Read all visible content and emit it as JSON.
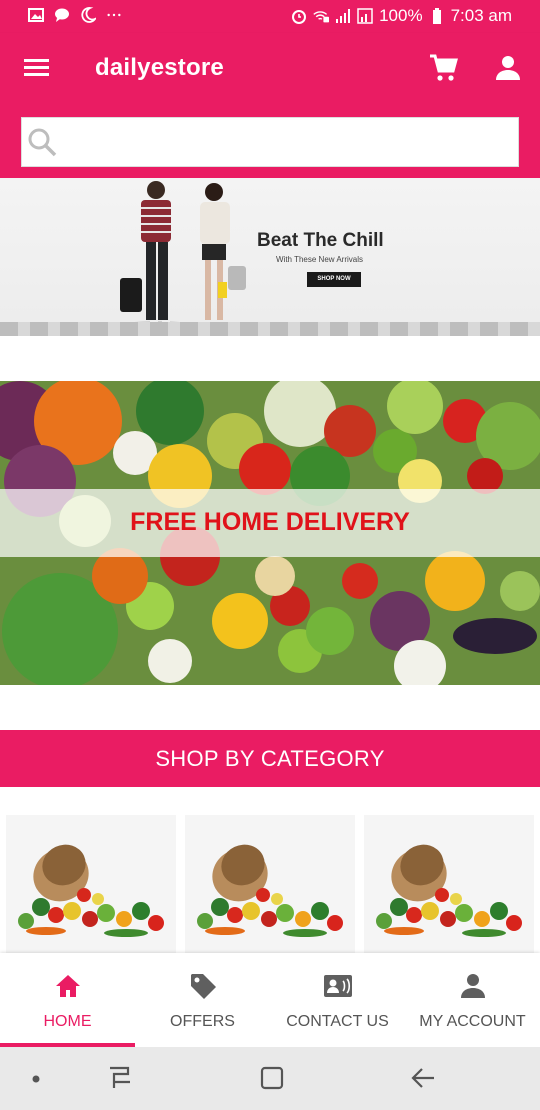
{
  "status_bar": {
    "battery": "100%",
    "time": "7:03 am"
  },
  "app_bar": {
    "title": "dailyestore"
  },
  "search": {
    "value": "",
    "placeholder": ""
  },
  "banner_fashion": {
    "headline": "Beat The Chill",
    "subline": "With These New Arrivals",
    "cta": "SHOP NOW"
  },
  "banner_delivery": {
    "text": "FREE HOME DELIVERY"
  },
  "category_section": {
    "title": "SHOP BY CATEGORY",
    "cards": [
      "vegetable-basket-image",
      "vegetable-basket-image",
      "vegetable-basket-image"
    ]
  },
  "bottom_nav": {
    "items": [
      {
        "label": "HOME",
        "icon": "home-icon",
        "active": true
      },
      {
        "label": "OFFERS",
        "icon": "tag-icon",
        "active": false
      },
      {
        "label": "CONTACT US",
        "icon": "contact-card-icon",
        "active": false
      },
      {
        "label": "MY ACCOUNT",
        "icon": "person-icon",
        "active": false
      }
    ]
  },
  "colors": {
    "accent": "#ea1c63",
    "highlight_text": "#e0121a",
    "nav_inactive": "#555555",
    "system_bar": "#e9e9e9"
  }
}
